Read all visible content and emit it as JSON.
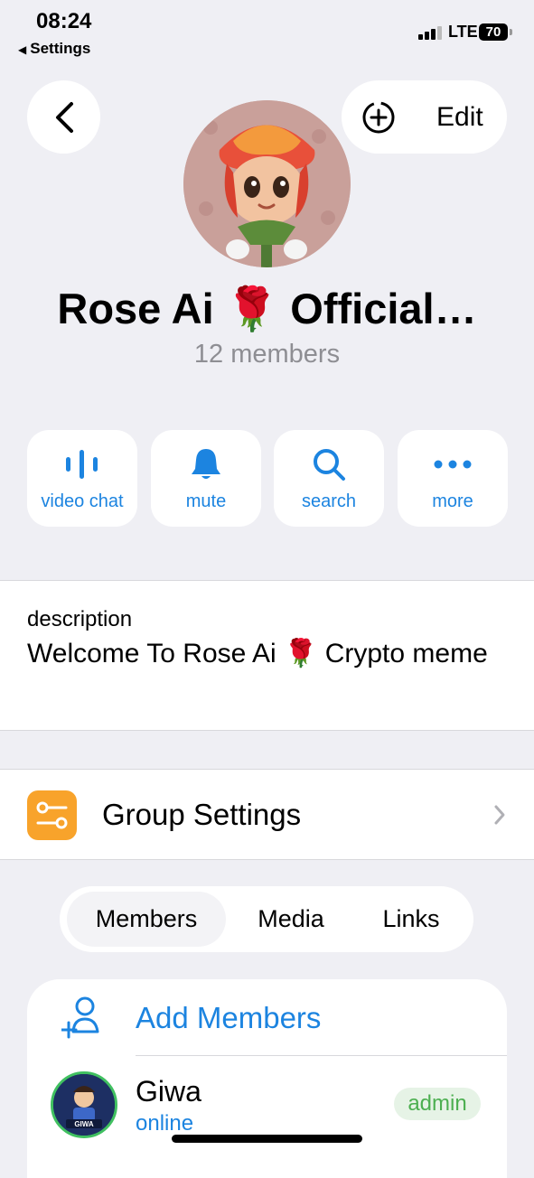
{
  "status_bar": {
    "time": "08:24",
    "back_app": "Settings",
    "network": "LTE",
    "battery": "70"
  },
  "nav": {
    "edit_label": "Edit"
  },
  "group": {
    "name": "Rose Ai 🌹 Official…",
    "members_count": "12 members"
  },
  "actions": [
    {
      "label": "video chat",
      "icon": "voice-wave-icon"
    },
    {
      "label": "mute",
      "icon": "bell-icon"
    },
    {
      "label": "search",
      "icon": "search-icon"
    },
    {
      "label": "more",
      "icon": "more-dots-icon"
    }
  ],
  "description": {
    "label": "description",
    "text": "Welcome To Rose Ai 🌹 Crypto meme"
  },
  "settings": {
    "label": "Group Settings"
  },
  "tabs": [
    {
      "label": "Members",
      "active": true
    },
    {
      "label": "Media",
      "active": false
    },
    {
      "label": "Links",
      "active": false
    }
  ],
  "members": {
    "add_label": "Add Members",
    "list": [
      {
        "name": "Giwa",
        "status": "online",
        "badge": "admin",
        "avatar_text": "GIWA"
      }
    ]
  },
  "colors": {
    "accent": "#1c84e0",
    "background": "#efeff4",
    "settings_icon": "#f8a32b",
    "admin_badge": "#4caf50"
  }
}
